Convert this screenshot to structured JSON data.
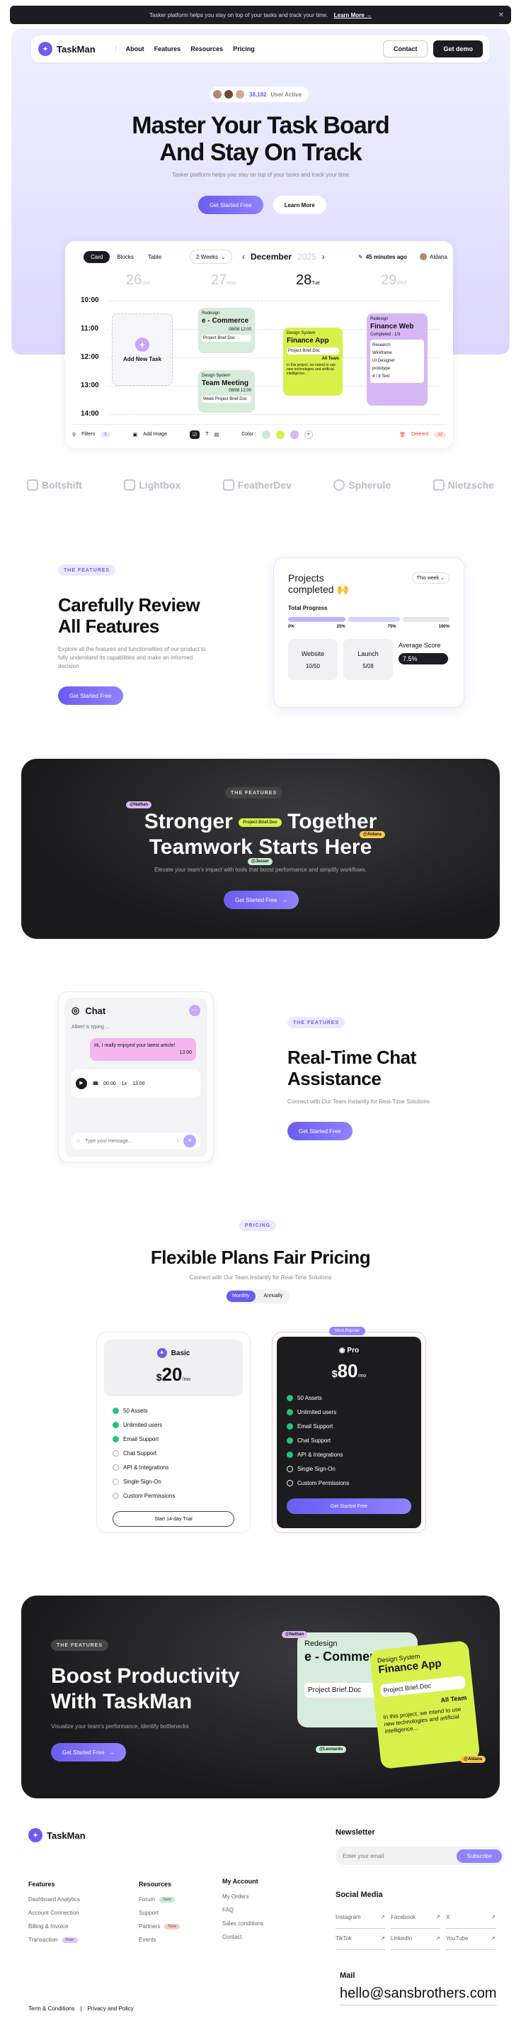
{
  "announcement": {
    "text": "Tasker platform helps you stay on top of your tasks and track your time.",
    "link": "Learn More →",
    "close": "✕"
  },
  "nav": {
    "brand": "TaskMan",
    "links": [
      "About",
      "Features",
      "Resources",
      "Pricing"
    ],
    "contact": "Contact",
    "demo": "Get demo"
  },
  "hero": {
    "users_count": "38,182",
    "users_label": "User Active",
    "title_l1": "Master Your Task Board",
    "title_l2": "And Stay On Track",
    "subtitle": "Tasker platform helps you stay on top of your tasks and track your time",
    "cta": "Get Started Free",
    "learn": "Learn More"
  },
  "board": {
    "tabs": [
      "Card",
      "Blocks",
      "Table"
    ],
    "range": "2 Weeks",
    "month": "December",
    "year": "2025",
    "updated": "45 minutes ago",
    "user": "Aldana",
    "days": [
      {
        "n": "26",
        "d": "Sun"
      },
      {
        "n": "27",
        "d": "Mon"
      },
      {
        "n": "28",
        "d": "Tue"
      },
      {
        "n": "29",
        "d": "Wed"
      }
    ],
    "times": [
      "10:00",
      "11:00",
      "12:00",
      "13:00",
      "14:00"
    ],
    "add_task": "Add New Task",
    "c1": {
      "tag": "Redesign",
      "title": "e - Commerce",
      "due": "08/08 12:00",
      "brief": "Project Brief.Doc"
    },
    "c2": {
      "tag": "Design System",
      "title": "Team Meeting",
      "due": "08/08 12:00",
      "brief": "Week Project Brief.Doc"
    },
    "c3": {
      "tag": "Design System",
      "title": "Finance App",
      "brief": "Project Brief.Doc",
      "team": "All Team",
      "desc": "In this project, we intend to use new technologies and artificial intelligence..."
    },
    "c4": {
      "tag": "Redesign",
      "title": "Finance Web",
      "completed": "Completed : 1/3",
      "items": [
        "Research",
        "Wireframe",
        "UI Designer",
        "prototype"
      ],
      "extra": "4 / 8 Text"
    },
    "toolbar": {
      "filters": "Filters",
      "filters_n": "3",
      "image": "Add Image",
      "color": "Color :",
      "deleted": "Deleted",
      "deleted_n": "12"
    }
  },
  "brands": [
    "Boltshift",
    "Lightbox",
    "FeatherDev",
    "Spherule",
    "Nietzsche"
  ],
  "features": {
    "pill": "THE FEATURES",
    "title_l1": "Carefully Review",
    "title_l2": "All Features",
    "desc": "Explore all the features and functionalities of our product to fully understand its capabilities and make an informed decision",
    "cta": "Get Started Free",
    "widget": {
      "title": "Projects completed",
      "emoji": "🙌",
      "period": "This week",
      "total": "Total Progress",
      "pcts": [
        "0%",
        "25%",
        "75%",
        "100%"
      ],
      "website": "Website",
      "website_v": "10/50",
      "launch": "Launch",
      "launch_v": "5/08",
      "avg": "Average Score",
      "avg_v": "7.5%"
    }
  },
  "teamwork": {
    "pill": "THE FEATURES",
    "title_l1a": "Stronger",
    "title_l1b": "Together",
    "title_l2": "Teamwork Starts Here",
    "desc": "Elevate your team's impact with tools that boost performance and simplify workflows.",
    "cta": "Get Started Free",
    "tag1": "@Nathan",
    "tag2": "@Aldana",
    "tag3": "@Jesser",
    "brief": "Project Brief.Doc"
  },
  "chat": {
    "title": "Chat",
    "typing": "Albert is typing ...",
    "msg": "Hi, I really enjoyed your latest article!",
    "msg_time": "13:00",
    "voice_len": "00:00",
    "voice_speed": "1x",
    "voice_time": "13:00",
    "placeholder": "Type your message...",
    "pill": "THE FEATURES",
    "h_l1": "Real-Time Chat",
    "h_l2": "Assistance",
    "desc": "Connect with Our Team Instantly for Real-Time Solutions",
    "cta": "Get Started Free"
  },
  "pricing": {
    "pill": "PRICING",
    "title": "Flexible Plans Fair Pricing",
    "desc": "Connect with Our Team Instantly for Real-Time Solutions",
    "toggle": [
      "Monthly",
      "Annually"
    ],
    "basic": {
      "name": "Basic",
      "currency": "$",
      "price": "20",
      "per": "/mo",
      "features": [
        "50 Assets",
        "Unlimited users",
        "Email Support",
        "Chat Support",
        "API & Integrations",
        "Single Sign-On",
        "Custom Permissions"
      ],
      "included": 3,
      "cta": "Start 14-day Trial"
    },
    "pro": {
      "badge": "Most Popular",
      "name": "Pro",
      "currency": "$",
      "price": "80",
      "per": "/mo",
      "features": [
        "50 Assets",
        "Unlimited users",
        "Email Support",
        "Chat Support",
        "API & Integrations",
        "Single Sign-On",
        "Custom Permissions"
      ],
      "included": 5,
      "cta": "Get Started Free"
    }
  },
  "boost": {
    "pill": "THE FEATURES",
    "title_l1": "Boost Productivity",
    "title_l2": "With TaskMan",
    "desc": "Visualize your team's performance, identify bottlenecks",
    "cta": "Get Started Free",
    "c1_tag": "Redesign",
    "c1_title": "e - Commerce",
    "c1_brief": "Project Brief.Doc",
    "c2_tag": "Design System",
    "c2_title": "Finance App",
    "c2_brief": "Project Brief.Doc",
    "c2_team": "All Team",
    "c2_desc": "In this project, we intend to use new technologies and artificial intelligence...",
    "tag1": "@Nathan",
    "tag2": "@Leonardo",
    "tag3": "@Aldana"
  },
  "footer": {
    "brand": "TaskMan",
    "newsletter": "Newsletter",
    "email_placeholder": "Enter your email",
    "subscribe": "Subscribe",
    "cols": [
      {
        "title": "Features",
        "items": [
          "Dashboard Analytics",
          "Account Connection",
          "Billing & Invoice",
          "Transaction"
        ]
      },
      {
        "title": "Resources",
        "items": [
          "Forum",
          "Support",
          "Partners",
          "Events"
        ]
      },
      {
        "title": "My Account",
        "items": [
          "My Orders",
          "FAQ",
          "Sales conditions",
          "Contact"
        ]
      }
    ],
    "badges": {
      "transaction": "New",
      "forum": "New",
      "partners": "New"
    },
    "social_title": "Social Media",
    "social": [
      "Instagram",
      "Facebook",
      "X",
      "TikTok",
      "LinkedIn",
      "YouTube"
    ],
    "mail_label": "Mail",
    "mail": "hello@sansbrothers.com",
    "terms": "Term & Conditions",
    "privacy": "Privacy and Policy"
  },
  "colors": {
    "accent": "#6b5cf0",
    "dark": "#1c1c22",
    "lime": "#d8f04a",
    "green_card": "#d8ecde",
    "purple_card": "#d7b8f5",
    "pink": "#f5b6f0"
  }
}
